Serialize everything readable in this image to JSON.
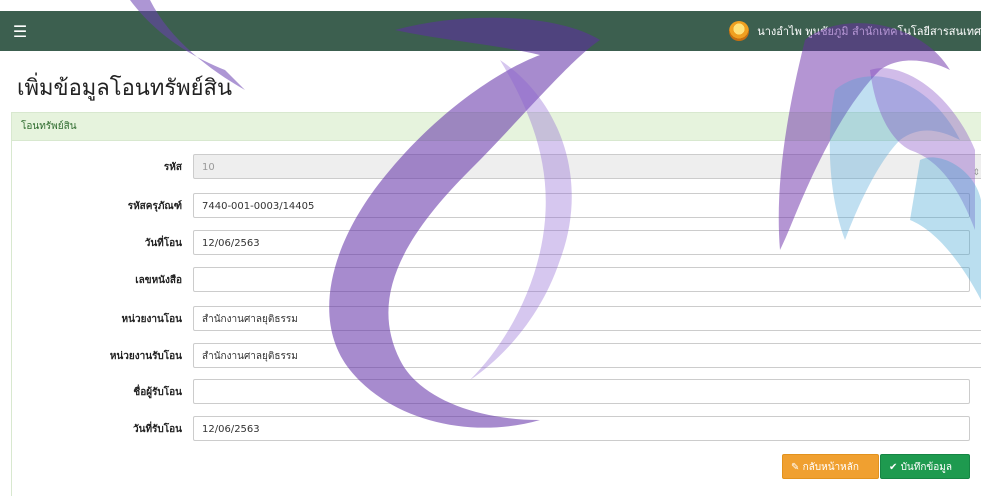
{
  "topbar": {
    "menu_icon": "hamburger-icon",
    "user_text": "นางอำไพ พูนชัยภูมิ สำนักเทคโนโลยีสารสนเทศ",
    "color": "#3c5f4f"
  },
  "page": {
    "title": "เพิ่มข้อมูลโอนทรัพย์สิน"
  },
  "panel": {
    "heading": "โอนทรัพย์สิน"
  },
  "form": {
    "code": {
      "label": "รหัส",
      "value": "10"
    },
    "equipment_code": {
      "label": "รหัสครุภัณฑ์",
      "value": "7440-001-0003/14405"
    },
    "transfer_date": {
      "label": "วันที่โอน",
      "value": "12/06/2563"
    },
    "document_no": {
      "label": "เลขหนังสือ",
      "value": ""
    },
    "from_unit": {
      "label": "หน่วยงานโอน",
      "value": "สำนักงานศาลยุติธรรม"
    },
    "to_unit": {
      "label": "หน่วยงานรับโอน",
      "value": "สำนักงานศาลยุติธรรม"
    },
    "receiver_name": {
      "label": "ชื่อผู้รับโอน",
      "value": ""
    },
    "receive_date": {
      "label": "วันที่รับโอน",
      "value": "12/06/2563"
    }
  },
  "buttons": {
    "back": {
      "label": "กลับหน้าหลัก",
      "icon": "edit-icon"
    },
    "save": {
      "label": "บันทึกข้อมูล",
      "icon": "check-icon"
    }
  },
  "colors": {
    "warning": "#f0a030",
    "success": "#1e9a4f",
    "panel_heading": "#e6f3dd"
  }
}
